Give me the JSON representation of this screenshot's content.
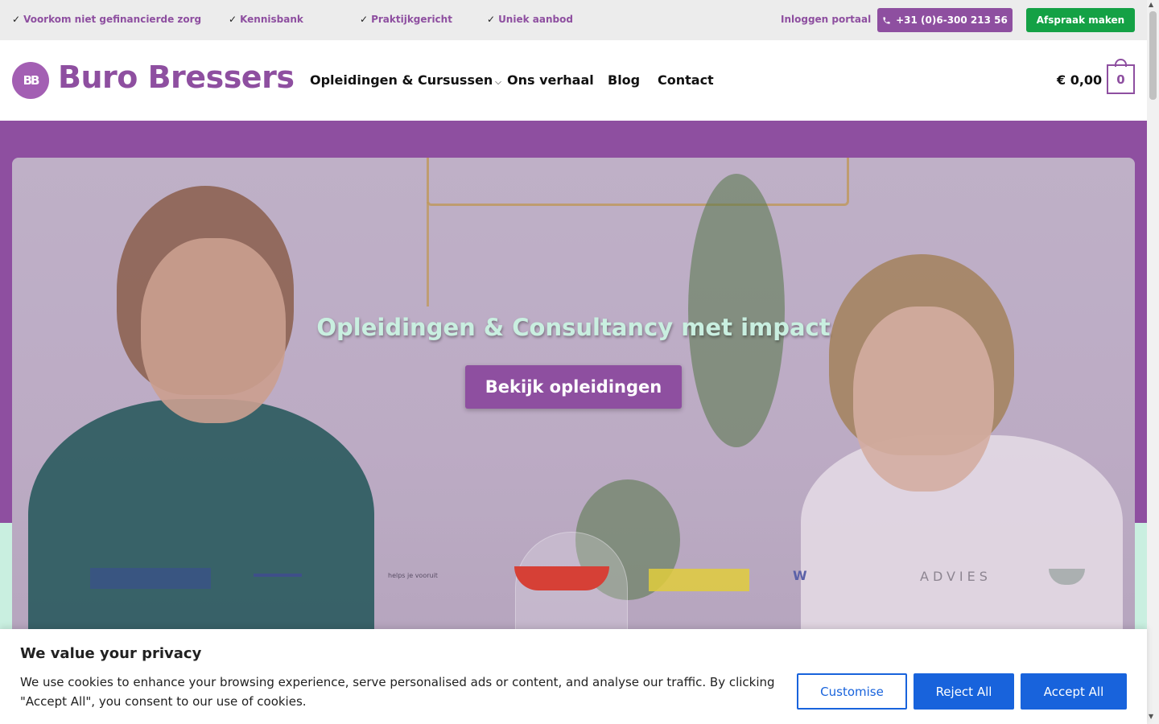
{
  "topbar": {
    "usps": [
      "Voorkom niet gefinancierde zorg",
      "Kennisbank",
      "Praktijkgericht",
      "Uniek aanbod"
    ],
    "check_glyph": "✓",
    "login": "Inloggen portaal",
    "phone": "+31 (0)6-300 213 56",
    "phone_icon": "phone-icon",
    "appointment": "Afspraak maken"
  },
  "header": {
    "logo_initials": "BB",
    "logo_text": "Buro Bressers",
    "nav": [
      "Opleidingen & Cursussen",
      "Ons verhaal",
      "Blog",
      "Contact"
    ],
    "cart_total": "€ 0,00",
    "cart_count": "0"
  },
  "hero": {
    "title": "Opleidingen & Consultancy met impact",
    "button": "Bekijk opleidingen"
  },
  "partners": {
    "items": [
      "helps je vooruit",
      "W",
      "ADVIES"
    ]
  },
  "cookie": {
    "title": "We value your privacy",
    "text": "We use cookies to enhance your browsing experience, serve personalised ads or content, and analyse our traffic. By clicking \"Accept All\", you consent to our use of cookies.",
    "customise": "Customise",
    "reject": "Reject All",
    "accept": "Accept All"
  },
  "colors": {
    "brand_purple": "#8e4fa0",
    "green_button": "#14a145",
    "mint": "#c9efe0",
    "cookie_blue": "#1863dc"
  }
}
